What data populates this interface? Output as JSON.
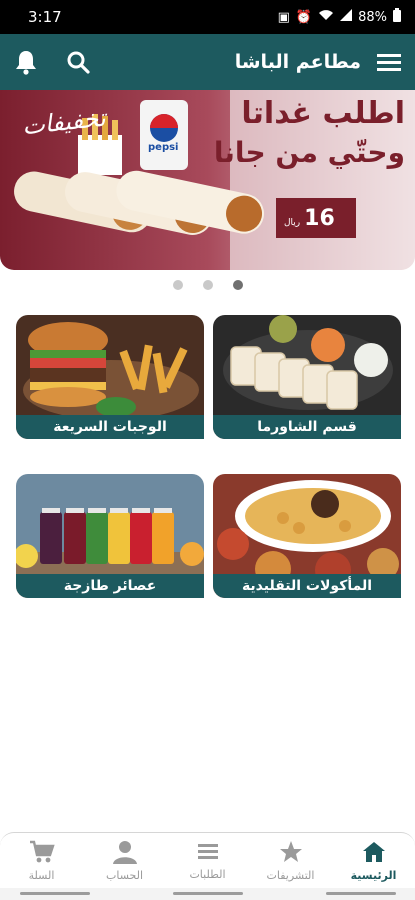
{
  "status_bar": {
    "time": "3:17",
    "battery": "88%",
    "icons": [
      "sim-icon",
      "alarm-icon",
      "wifi-icon",
      "signal-icon",
      "battery-icon"
    ]
  },
  "app_bar": {
    "title": "مطاعم الباشا",
    "menu_icon": "menu-icon",
    "search_icon": "search-icon",
    "bell_icon": "bell-icon"
  },
  "banner": {
    "headline_1": "اطلب غداتا",
    "headline_2": "وحتّي من جانا",
    "side_word": "تخفيفات",
    "price": "16",
    "currency": "ريال",
    "brand": "pepsi"
  },
  "carousel": {
    "count": 3,
    "active_index": 2
  },
  "categories": [
    {
      "label": "قسم الشاورما"
    },
    {
      "label": "الوجبات السريعة"
    },
    {
      "label": "المأكولات التقليدية"
    },
    {
      "label": "عصائر طازجة"
    }
  ],
  "bottom_nav": [
    {
      "label": "الرئيسية",
      "icon": "home-icon"
    },
    {
      "label": "التشريفات",
      "icon": "star-icon"
    },
    {
      "label": "الطلبات",
      "icon": "list-icon"
    },
    {
      "label": "الحساب",
      "icon": "user-icon"
    },
    {
      "label": "السلة",
      "icon": "cart-icon"
    }
  ],
  "colors": {
    "primary": "#1d5a5f",
    "banner_red": "#7a1f2b",
    "nav_inactive": "#9a9a9a"
  }
}
